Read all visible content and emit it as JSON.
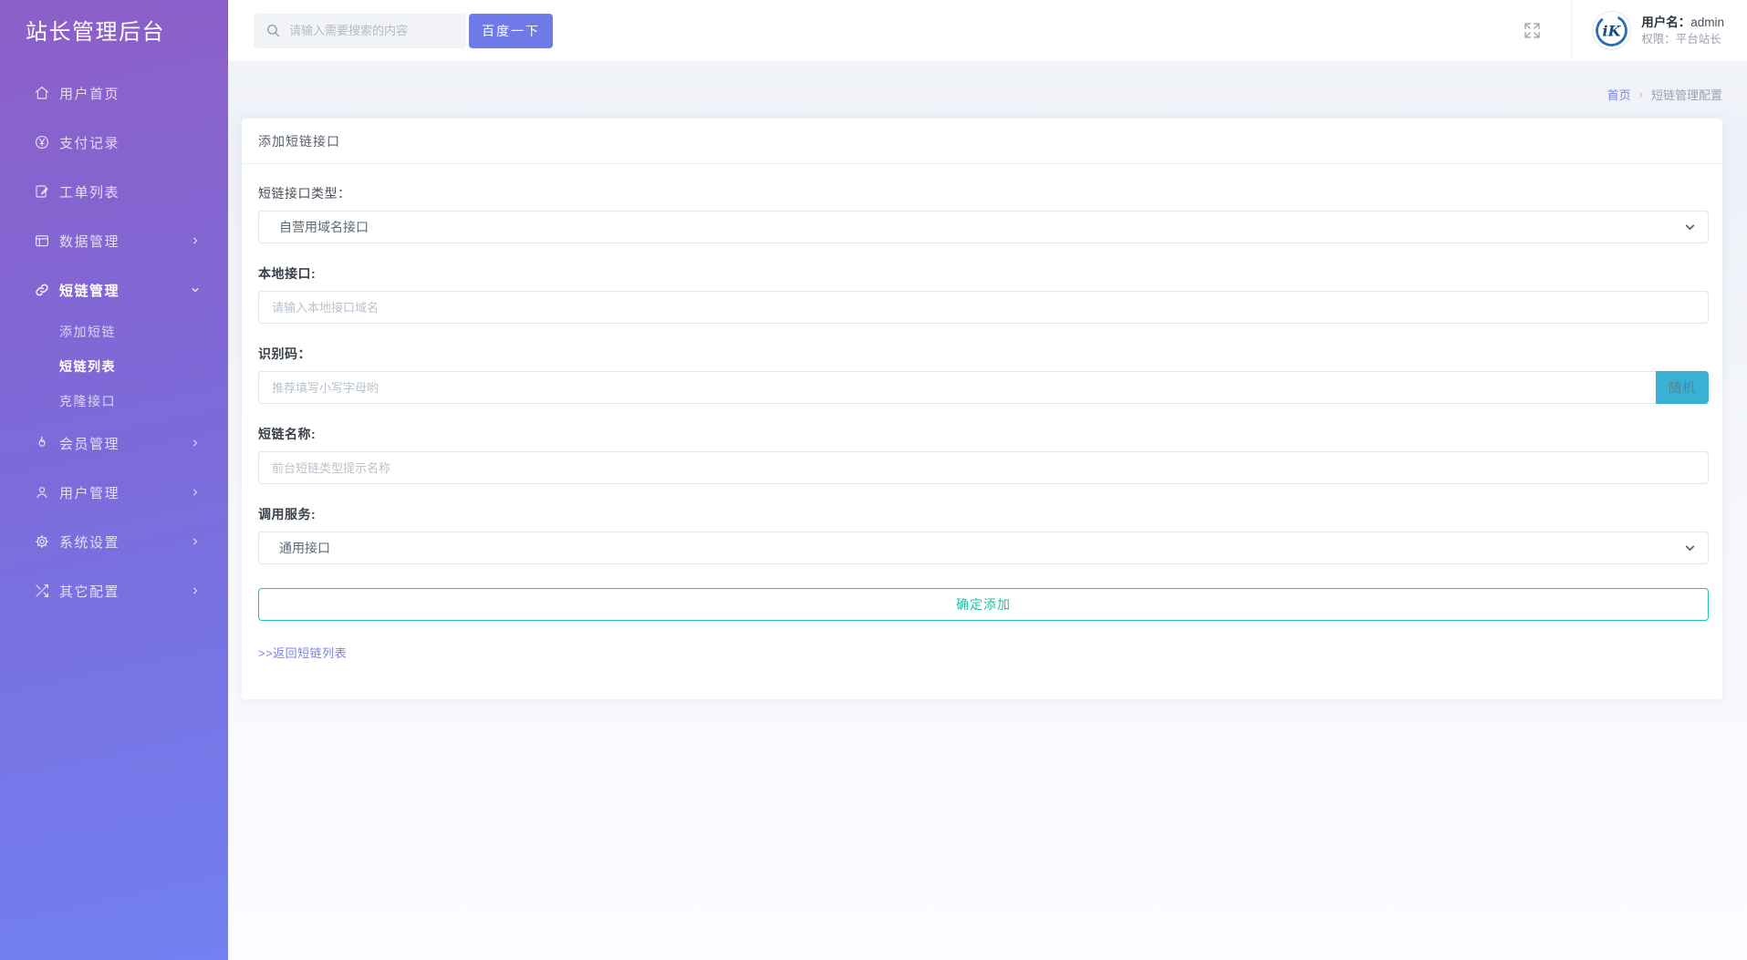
{
  "app": {
    "title": "站长管理后台"
  },
  "topbar": {
    "search": {
      "placeholder": "请输入需要搜索的内容",
      "button_label": "百度一下"
    },
    "user": {
      "avatar_text": "iK",
      "name_label": "用户名：",
      "name": "admin",
      "role_label": "权限：",
      "role": "平台站长"
    }
  },
  "sidebar": {
    "items": [
      {
        "label": "用户首页",
        "icon": "home-icon",
        "expandable": false
      },
      {
        "label": "支付记录",
        "icon": "yen-circle-icon",
        "expandable": false
      },
      {
        "label": "工单列表",
        "icon": "ticket-icon",
        "expandable": false
      },
      {
        "label": "数据管理",
        "icon": "data-icon",
        "expandable": true
      },
      {
        "label": "短链管理",
        "icon": "link-icon",
        "expandable": true,
        "expanded": true,
        "active": true,
        "children": [
          {
            "label": "添加短链",
            "active": false
          },
          {
            "label": "短链列表",
            "active": true
          },
          {
            "label": "克隆接口",
            "active": false
          }
        ]
      },
      {
        "label": "会员管理",
        "icon": "flame-icon",
        "expandable": true
      },
      {
        "label": "用户管理",
        "icon": "user-icon",
        "expandable": true
      },
      {
        "label": "系统设置",
        "icon": "gear-icon",
        "expandable": true
      },
      {
        "label": "其它配置",
        "icon": "shuffle-icon",
        "expandable": true
      }
    ]
  },
  "breadcrumb": {
    "home": "首页",
    "separator": "›",
    "current": "短链管理配置"
  },
  "page": {
    "card_title": "添加短链接口",
    "form": {
      "api_type": {
        "label": "短链接口类型：",
        "value": "自营用域名接口"
      },
      "local_api": {
        "label": "本地接口:",
        "placeholder": "请输入本地接口域名"
      },
      "code": {
        "label": "识别码：",
        "placeholder": "推荐填写小写字母哟",
        "random_button": "随机"
      },
      "name": {
        "label": "短链名称:",
        "placeholder": "前台短链类型提示名称"
      },
      "service": {
        "label": "调用服务:",
        "value": "通用接口"
      },
      "submit_label": "确定添加",
      "back_link": ">>返回短链列表"
    }
  },
  "colors": {
    "sidebar_gradient_top": "#8d5fc8",
    "sidebar_gradient_bottom": "#7180f2",
    "accent_purple": "#7079e8",
    "link_purple": "#7a81e8",
    "random_button_cyan": "#39b0d6",
    "submit_teal": "#21c5a7"
  }
}
